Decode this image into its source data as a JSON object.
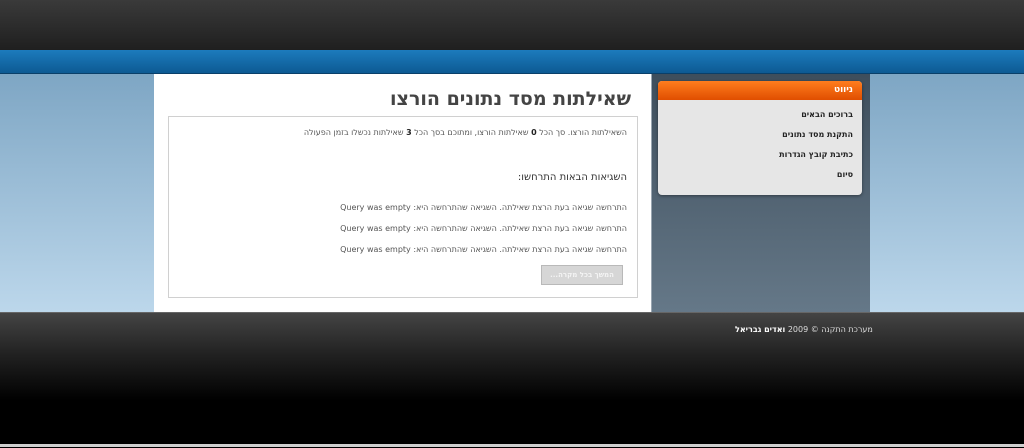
{
  "header": {},
  "main": {
    "title": "שאילתות מסד נתונים הורצו",
    "summary": {
      "prefix": "השאילתות הורצו. סך הכל",
      "total_count": "0",
      "middle": "שאילתות הורצו, ומתוכם בסך הכל",
      "failed_count": "3",
      "suffix": "שאילתות נכשלו בזמן הפעולה"
    },
    "errors_heading": "השגיאות הבאות התרחשו:",
    "errors": [
      {
        "prefix": "התרחשה שגיאה בעת הרצת שאילתה. השגיאה שהתרחשה היא:",
        "message": "Query was empty"
      },
      {
        "prefix": "התרחשה שגיאה בעת הרצת שאילתה. השגיאה שהתרחשה היא:",
        "message": "Query was empty"
      },
      {
        "prefix": "התרחשה שגיאה בעת הרצת שאילתה. השגיאה שהתרחשה היא:",
        "message": "Query was empty"
      }
    ],
    "continue_button": "המשך בכל מקרה..."
  },
  "sidebar": {
    "nav_title": "ניווט",
    "items": [
      {
        "label": "ברוכים הבאים"
      },
      {
        "label": "התקנת מסד נתונים"
      },
      {
        "label": "כתיבת קובץ הגדרות"
      },
      {
        "label": "סיום"
      }
    ]
  },
  "footer": {
    "text": "מערכת התקנה © 2009",
    "author": "ואדים גבריאל"
  },
  "colors": {
    "accent_orange": "#f26a10",
    "blue_bar": "#1470b0"
  }
}
